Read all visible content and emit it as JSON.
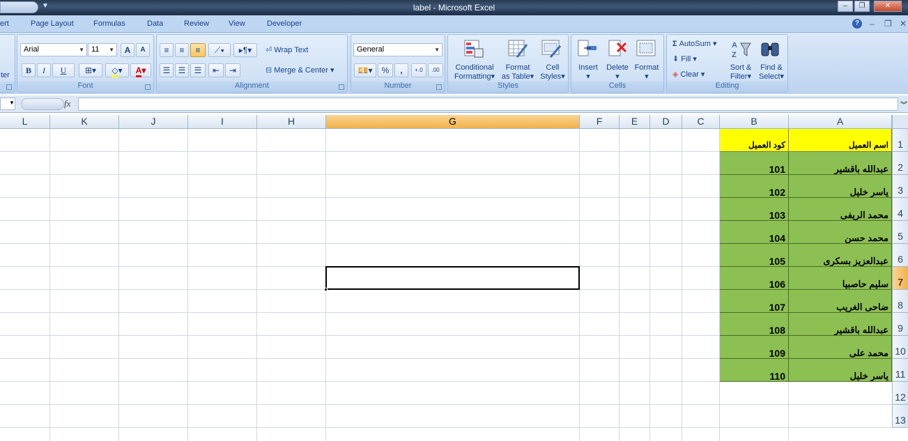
{
  "window": {
    "title": "label - Microsoft Excel",
    "minimize": "–",
    "restore": "❐",
    "close": "✕"
  },
  "tabs": [
    {
      "label": "ert",
      "id": "insert"
    },
    {
      "label": "Page Layout",
      "id": "page-layout"
    },
    {
      "label": "Formulas",
      "id": "formulas"
    },
    {
      "label": "Data",
      "id": "data"
    },
    {
      "label": "Review",
      "id": "review"
    },
    {
      "label": "View",
      "id": "view"
    },
    {
      "label": "Developer",
      "id": "developer"
    }
  ],
  "ribbon": {
    "clipboard_partial": "ter",
    "font": {
      "name": "Arial",
      "size": "11",
      "label": "Font",
      "bold": "B",
      "italic": "I",
      "underline": "U",
      "grow": "A",
      "shrink": "A"
    },
    "alignment": {
      "label": "Alignment",
      "wrap_text": "Wrap Text",
      "merge_center": "Merge & Center"
    },
    "number": {
      "label": "Number",
      "format": "General",
      "percent": "%",
      "comma": ",",
      "inc_decimal": "←.0 .00",
      "dec_decimal": ".00 →.0"
    },
    "styles": {
      "label": "Styles",
      "conditional_1": "Conditional",
      "conditional_2": "Formatting",
      "format_table_1": "Format",
      "format_table_2": "as Table",
      "cell_styles_1": "Cell",
      "cell_styles_2": "Styles"
    },
    "cells": {
      "label": "Cells",
      "insert": "Insert",
      "delete": "Delete",
      "format": "Format"
    },
    "editing": {
      "label": "Editing",
      "autosum": "AutoSum",
      "fill": "Fill",
      "clear": "Clear",
      "sort_1": "Sort &",
      "sort_2": "Filter",
      "find_1": "Find &",
      "find_2": "Select"
    }
  },
  "formula_bar": {
    "fx": "fx",
    "value": ""
  },
  "columns": [
    "L",
    "K",
    "J",
    "I",
    "H",
    "G",
    "F",
    "E",
    "D",
    "C",
    "B",
    "A"
  ],
  "selected_column": "G",
  "rows": [
    "1",
    "2",
    "3",
    "4",
    "5",
    "6",
    "7",
    "8",
    "9",
    "10",
    "11",
    "12",
    "13"
  ],
  "selected_row": "7",
  "sheet": {
    "header": {
      "name": "اسم العميل",
      "code": "كود العميل"
    },
    "records": [
      {
        "name": "عبدالله باقشير",
        "code": "101"
      },
      {
        "name": "ياسر خليل",
        "code": "102"
      },
      {
        "name": "محمد الريفى",
        "code": "103"
      },
      {
        "name": "محمد حسن",
        "code": "104"
      },
      {
        "name": "عبدالعزيز بسكرى",
        "code": "105"
      },
      {
        "name": "سليم حاصبيا",
        "code": "106"
      },
      {
        "name": "ضاحى الغريب",
        "code": "107"
      },
      {
        "name": "عبدالله باقشير",
        "code": "108"
      },
      {
        "name": "محمد على",
        "code": "109"
      },
      {
        "name": "ياسر خليل",
        "code": "110"
      }
    ]
  },
  "colors": {
    "header_fill": "#ffff00",
    "data_fill": "#8cc052",
    "selection_highlight": "#f1b24a"
  }
}
